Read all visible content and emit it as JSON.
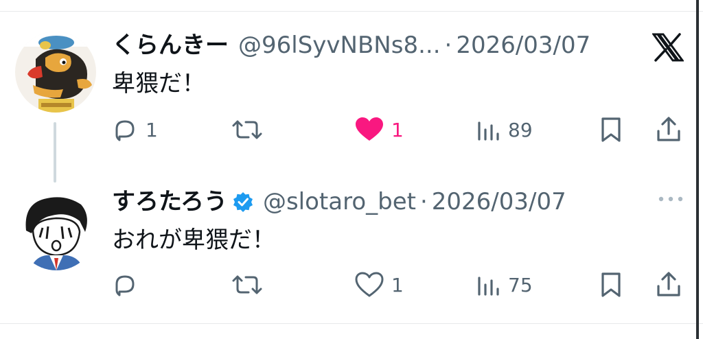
{
  "colors": {
    "text": "#0f1419",
    "muted": "#536471",
    "like_active": "#f91880",
    "verified_blue": "#1d9bf0",
    "divider": "#e7e9ea",
    "thread_line": "#cfd9de"
  },
  "tweets": [
    {
      "display_name": "くらんきー",
      "handle": "@96lSyvNBNs8...",
      "separator": "·",
      "date": "2026/03/07",
      "verified": false,
      "text": "卑猥だ！",
      "top_right_icon": "x-logo-icon",
      "actions": {
        "reply": {
          "icon": "reply-icon",
          "count": "1"
        },
        "retweet": {
          "icon": "retweet-icon",
          "count": ""
        },
        "like": {
          "icon": "heart-filled-icon",
          "count": "1",
          "active": true
        },
        "views": {
          "icon": "views-icon",
          "count": "89"
        },
        "bookmark": {
          "icon": "bookmark-icon"
        },
        "share": {
          "icon": "share-icon"
        }
      }
    },
    {
      "display_name": "すろたろう",
      "handle": "@slotaro_bet",
      "separator": "·",
      "date": "2026/03/07",
      "verified": true,
      "text": "おれが卑猥だ！",
      "top_right_icon": "more-icon",
      "actions": {
        "reply": {
          "icon": "reply-icon",
          "count": ""
        },
        "retweet": {
          "icon": "retweet-icon",
          "count": ""
        },
        "like": {
          "icon": "heart-outline-icon",
          "count": "1",
          "active": false
        },
        "views": {
          "icon": "views-icon",
          "count": "75"
        },
        "bookmark": {
          "icon": "bookmark-icon"
        },
        "share": {
          "icon": "share-icon"
        }
      }
    }
  ]
}
